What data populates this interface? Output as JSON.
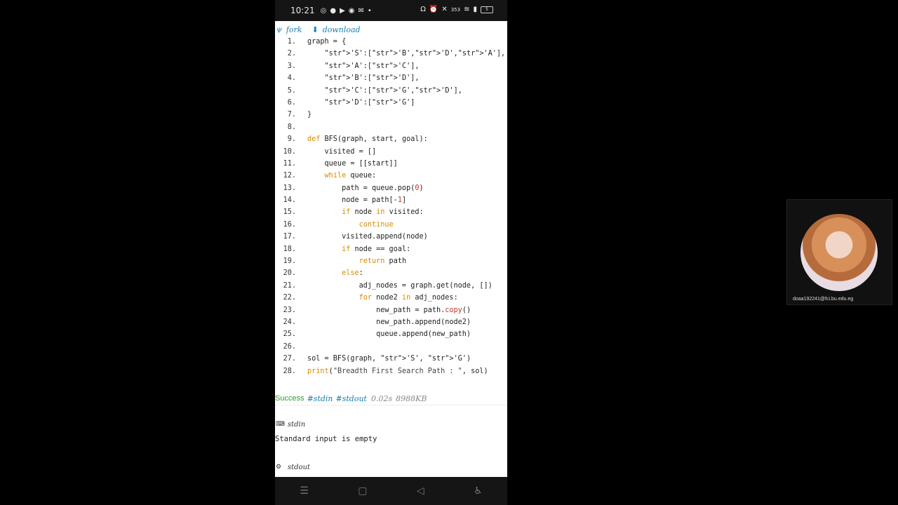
{
  "status_bar": {
    "time": "10:21",
    "left_icons": [
      "whatsapp-icon",
      "facebook-icon",
      "youtube-icon",
      "messenger-icon",
      "gmail-icon",
      "dot-icon"
    ],
    "right_icons": [
      "headset-icon",
      "alarm-icon",
      "mute-icon",
      "data-speed-icon",
      "wifi-icon",
      "signal-icon",
      "battery-icon"
    ],
    "data_speed": "353",
    "battery": "5"
  },
  "toolbar": {
    "fork_label": "fork",
    "download_label": "download"
  },
  "code_lines": [
    {
      "n": "1.",
      "text": "graph = {"
    },
    {
      "n": "2.",
      "text": "    'S':['B','D','A'],"
    },
    {
      "n": "3.",
      "text": "    'A':['C'],"
    },
    {
      "n": "4.",
      "text": "    'B':['D'],"
    },
    {
      "n": "5.",
      "text": "    'C':['G','D'],"
    },
    {
      "n": "6.",
      "text": "    'D':['G']"
    },
    {
      "n": "7.",
      "text": "}"
    },
    {
      "n": "8.",
      "text": ""
    },
    {
      "n": "9.",
      "text": "def BFS(graph, start, goal):"
    },
    {
      "n": "10.",
      "text": "    visited = []"
    },
    {
      "n": "11.",
      "text": "    queue = [[start]]"
    },
    {
      "n": "12.",
      "text": "    while queue:"
    },
    {
      "n": "13.",
      "text": "        path = queue.pop(0)"
    },
    {
      "n": "14.",
      "text": "        node = path[-1]"
    },
    {
      "n": "15.",
      "text": "        if node in visited:"
    },
    {
      "n": "16.",
      "text": "            continue"
    },
    {
      "n": "17.",
      "text": "        visited.append(node)"
    },
    {
      "n": "18.",
      "text": "        if node == goal:"
    },
    {
      "n": "19.",
      "text": "            return path"
    },
    {
      "n": "20.",
      "text": "        else:"
    },
    {
      "n": "21.",
      "text": "            adj_nodes = graph.get(node, [])"
    },
    {
      "n": "22.",
      "text": "            for node2 in adj_nodes:"
    },
    {
      "n": "23.",
      "text": "                new_path = path.copy()"
    },
    {
      "n": "24.",
      "text": "                new_path.append(node2)"
    },
    {
      "n": "25.",
      "text": "                queue.append(new_path)"
    },
    {
      "n": "26.",
      "text": ""
    },
    {
      "n": "27.",
      "text": "sol = BFS(graph, 'S', 'G')"
    },
    {
      "n": "28.",
      "text": "print(\"Breadth First Search Path : \", sol)"
    }
  ],
  "result": {
    "status": "Success",
    "stdin_tag": "#stdin",
    "stdout_tag": "#stdout",
    "time": "0.02s",
    "memory": "8988KB"
  },
  "stdin": {
    "label": "stdin",
    "text": "Standard input is empty"
  },
  "stdout": {
    "label": "stdout"
  },
  "nav_bar": {
    "icons": [
      "recents-icon",
      "home-icon",
      "back-icon",
      "accessibility-icon"
    ]
  },
  "webcam": {
    "email": "doaa192241@fci.bu.edu.eg"
  }
}
